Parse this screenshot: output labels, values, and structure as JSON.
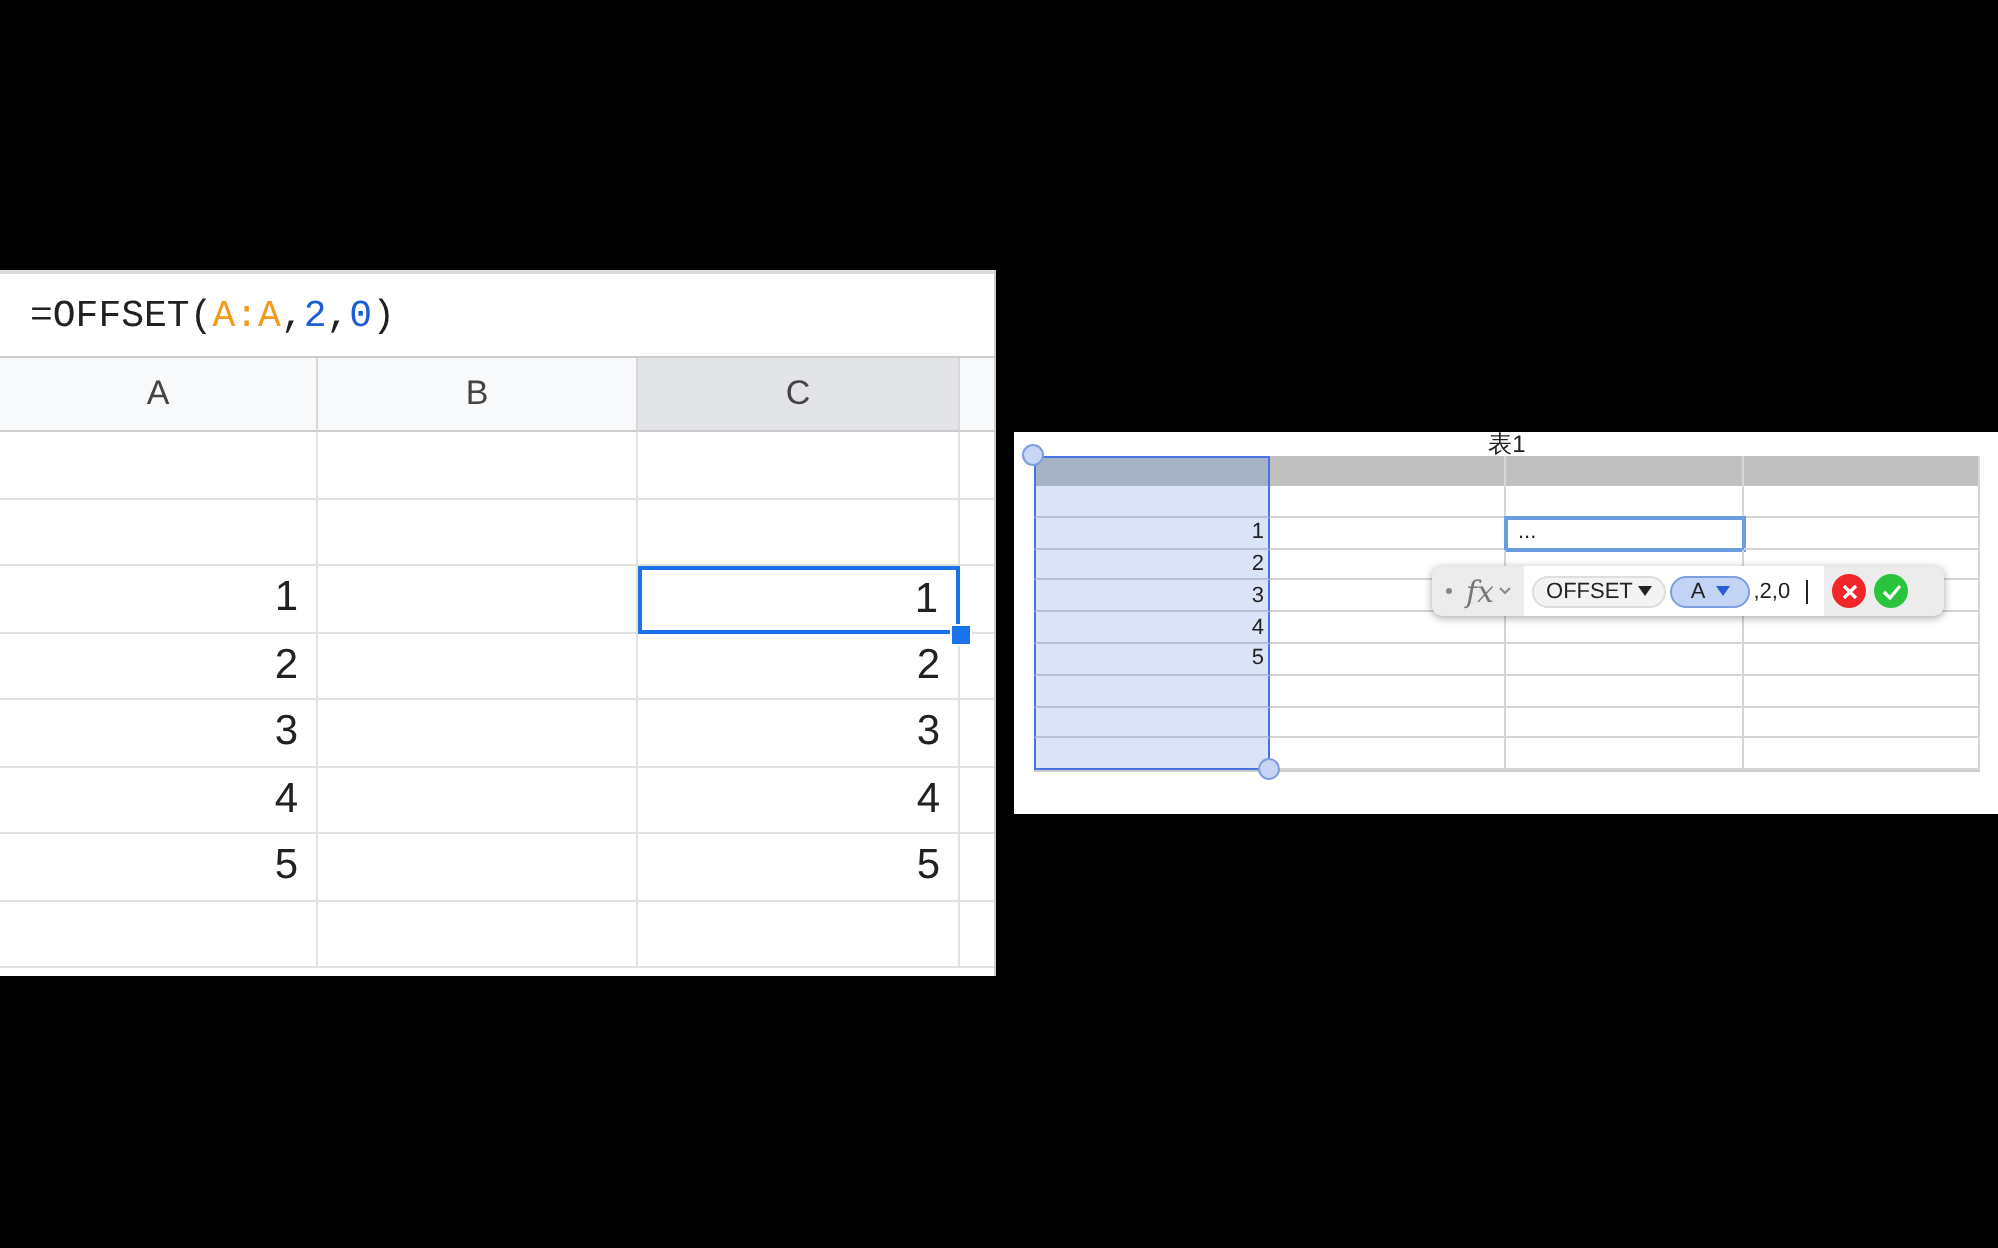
{
  "sheets": {
    "formula": [
      {
        "text": "=OFFSET(",
        "kind": "plain"
      },
      {
        "text": "A:A",
        "kind": "range"
      },
      {
        "text": ",",
        "kind": "plain"
      },
      {
        "text": "2",
        "kind": "number"
      },
      {
        "text": ",",
        "kind": "plain"
      },
      {
        "text": "0",
        "kind": "number"
      },
      {
        "text": ")",
        "kind": "plain"
      }
    ],
    "columns": [
      {
        "label": "A",
        "selected": false
      },
      {
        "label": "B",
        "selected": false
      },
      {
        "label": "C",
        "selected": true
      }
    ],
    "rows": [
      {
        "cells": [
          {
            "selected": false
          },
          {
            "selected": false
          },
          {
            "selected": false
          }
        ]
      },
      {
        "cells": [
          {
            "selected": false
          },
          {
            "selected": false
          },
          {
            "selected": false
          }
        ]
      },
      {
        "cells": [
          {
            "text": "1",
            "selected": false
          },
          {
            "selected": false
          },
          {
            "text": "1",
            "selected": true
          }
        ]
      },
      {
        "cells": [
          {
            "text": "2",
            "selected": false
          },
          {
            "selected": false
          },
          {
            "text": "2",
            "selected": false
          }
        ]
      },
      {
        "cells": [
          {
            "text": "3",
            "selected": false
          },
          {
            "selected": false
          },
          {
            "text": "3",
            "selected": false
          }
        ]
      },
      {
        "cells": [
          {
            "text": "4",
            "selected": false
          },
          {
            "selected": false
          },
          {
            "text": "4",
            "selected": false
          }
        ]
      },
      {
        "cells": [
          {
            "text": "5",
            "selected": false
          },
          {
            "selected": false
          },
          {
            "text": "5",
            "selected": false
          }
        ]
      },
      {
        "cells": [
          {
            "selected": false
          },
          {
            "selected": false
          },
          {
            "selected": false
          }
        ]
      }
    ]
  },
  "numbers": {
    "title": "表1",
    "columns": [
      {
        "selected": true
      },
      {
        "selected": false
      },
      {
        "selected": false
      },
      {
        "selected": false
      }
    ],
    "rows": [
      {
        "cells": [
          {
            "selected": false
          },
          {
            "selected": false
          },
          {
            "selected": false
          },
          {
            "selected": false
          }
        ]
      },
      {
        "cells": [
          {
            "text": "1",
            "selected": false
          },
          {
            "selected": false
          },
          {
            "text": "...",
            "selected": true
          },
          {
            "selected": false
          }
        ]
      },
      {
        "cells": [
          {
            "text": "2",
            "selected": false
          },
          {
            "selected": false
          },
          {
            "selected": false
          },
          {
            "selected": false
          }
        ]
      },
      {
        "cells": [
          {
            "text": "3",
            "selected": false
          },
          {
            "selected": false
          },
          {},
          {
            "selected": false
          }
        ]
      },
      {
        "cells": [
          {
            "text": "4",
            "selected": false
          },
          {
            "selected": false
          },
          {
            "selected": false
          },
          {
            "selected": false
          }
        ]
      },
      {
        "cells": [
          {
            "text": "5",
            "selected": false
          },
          {
            "selected": false
          },
          {
            "selected": false
          },
          {
            "selected": false
          }
        ]
      },
      {
        "cells": [
          {
            "selected": false
          },
          {
            "selected": false
          },
          {
            "selected": false
          },
          {
            "selected": false
          }
        ]
      },
      {
        "cells": [
          {
            "selected": false
          },
          {
            "selected": false
          },
          {
            "selected": false
          },
          {
            "selected": false
          }
        ]
      },
      {
        "cells": [
          {
            "selected": false
          },
          {
            "selected": false
          },
          {
            "selected": false
          },
          {
            "selected": false
          }
        ]
      }
    ],
    "formula_editor": {
      "fx": "fx",
      "tokens": [
        {
          "text": "OFFSET",
          "kind": "function"
        },
        {
          "text": "A",
          "kind": "reference"
        },
        {
          "text": ",2,0",
          "kind": "plain"
        }
      ]
    }
  }
}
